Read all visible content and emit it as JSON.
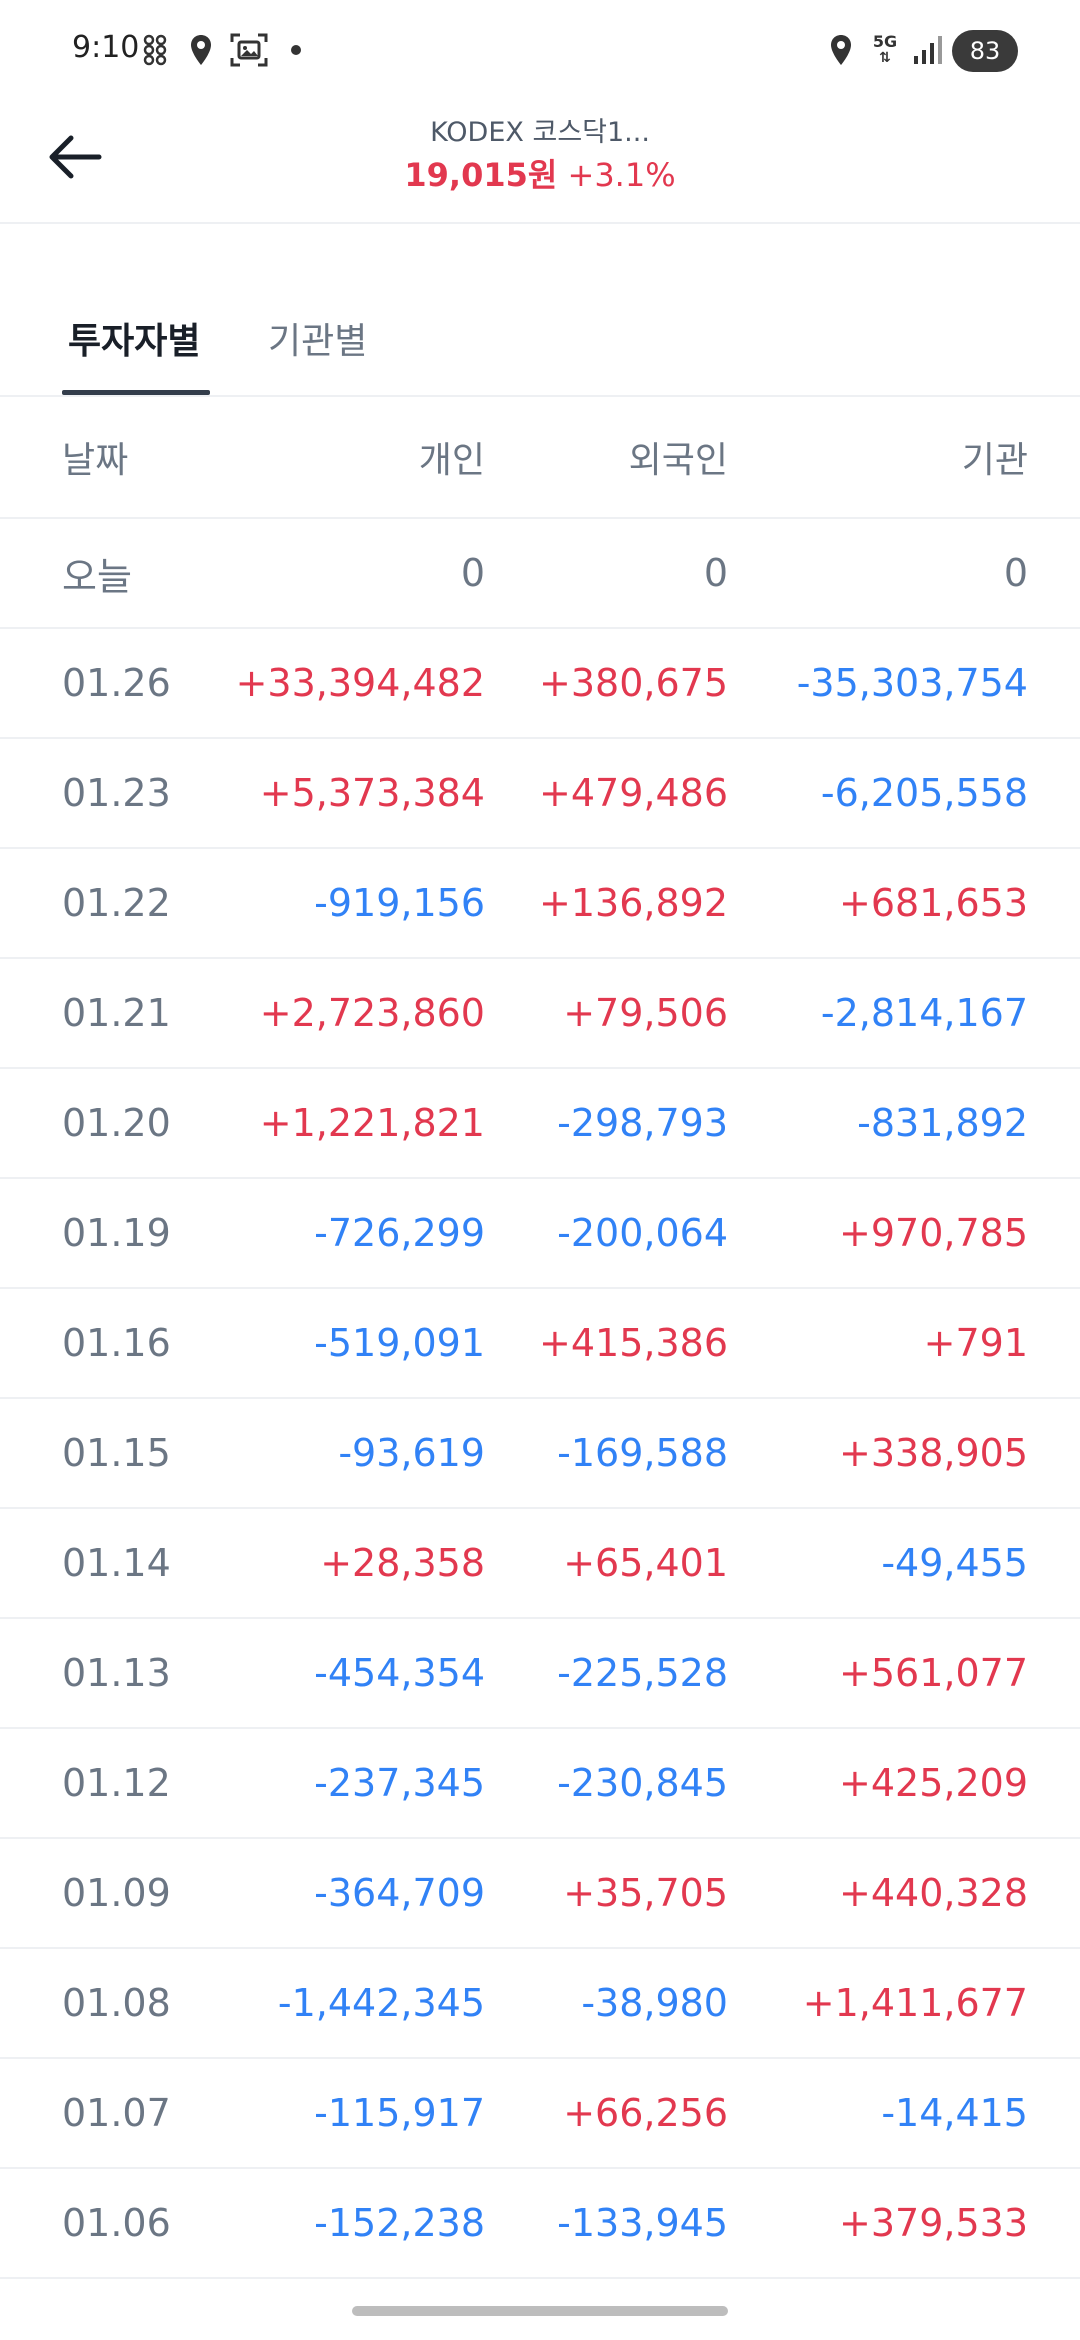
{
  "status_bar": {
    "time": "9:10",
    "battery": "83",
    "network": "5G"
  },
  "header": {
    "title": "KODEX 코스닥1...",
    "price": "19,015원",
    "change": "+3.1%"
  },
  "tabs": [
    "투자자별",
    "기관별"
  ],
  "columns": [
    "날짜",
    "개인",
    "외국인",
    "기관"
  ],
  "rows": [
    {
      "date": "오늘",
      "ind": "0",
      "for": "0",
      "ins": "0"
    },
    {
      "date": "01.26",
      "ind": "+33,394,482",
      "for": "+380,675",
      "ins": "-35,303,754"
    },
    {
      "date": "01.23",
      "ind": "+5,373,384",
      "for": "+479,486",
      "ins": "-6,205,558"
    },
    {
      "date": "01.22",
      "ind": "-919,156",
      "for": "+136,892",
      "ins": "+681,653"
    },
    {
      "date": "01.21",
      "ind": "+2,723,860",
      "for": "+79,506",
      "ins": "-2,814,167"
    },
    {
      "date": "01.20",
      "ind": "+1,221,821",
      "for": "-298,793",
      "ins": "-831,892"
    },
    {
      "date": "01.19",
      "ind": "-726,299",
      "for": "-200,064",
      "ins": "+970,785"
    },
    {
      "date": "01.16",
      "ind": "-519,091",
      "for": "+415,386",
      "ins": "+791"
    },
    {
      "date": "01.15",
      "ind": "-93,619",
      "for": "-169,588",
      "ins": "+338,905"
    },
    {
      "date": "01.14",
      "ind": "+28,358",
      "for": "+65,401",
      "ins": "-49,455"
    },
    {
      "date": "01.13",
      "ind": "-454,354",
      "for": "-225,528",
      "ins": "+561,077"
    },
    {
      "date": "01.12",
      "ind": "-237,345",
      "for": "-230,845",
      "ins": "+425,209"
    },
    {
      "date": "01.09",
      "ind": "-364,709",
      "for": "+35,705",
      "ins": "+440,328"
    },
    {
      "date": "01.08",
      "ind": "-1,442,345",
      "for": "-38,980",
      "ins": "+1,411,677"
    },
    {
      "date": "01.07",
      "ind": "-115,917",
      "for": "+66,256",
      "ins": "-14,415"
    },
    {
      "date": "01.06",
      "ind": "-152,238",
      "for": "-133,945",
      "ins": "+379,533"
    }
  ]
}
